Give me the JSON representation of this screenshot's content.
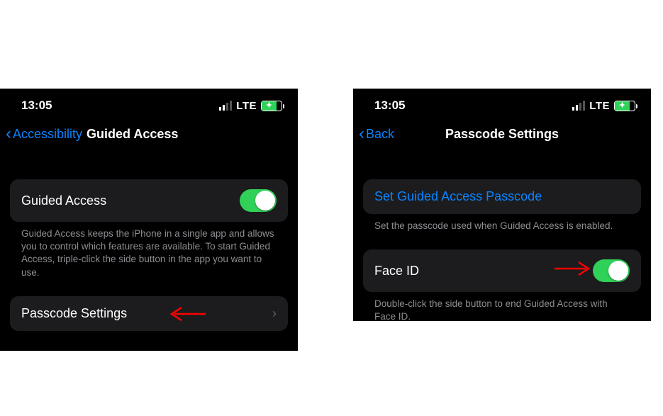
{
  "status": {
    "time": "13:05",
    "network": "LTE"
  },
  "left": {
    "back_label": "Accessibility",
    "title": "Guided Access",
    "guided_access": {
      "label": "Guided Access",
      "footer": "Guided Access keeps the iPhone in a single app and allows you to control which features are available. To start Guided Access, triple-click the side button in the app you want to use."
    },
    "passcode_settings": {
      "label": "Passcode Settings"
    }
  },
  "right": {
    "back_label": "Back",
    "title": "Passcode Settings",
    "set_passcode": {
      "label": "Set Guided Access Passcode",
      "footer": "Set the passcode used when Guided Access is enabled."
    },
    "face_id": {
      "label": "Face ID",
      "footer": "Double-click the side button to end Guided Access with Face ID."
    }
  }
}
